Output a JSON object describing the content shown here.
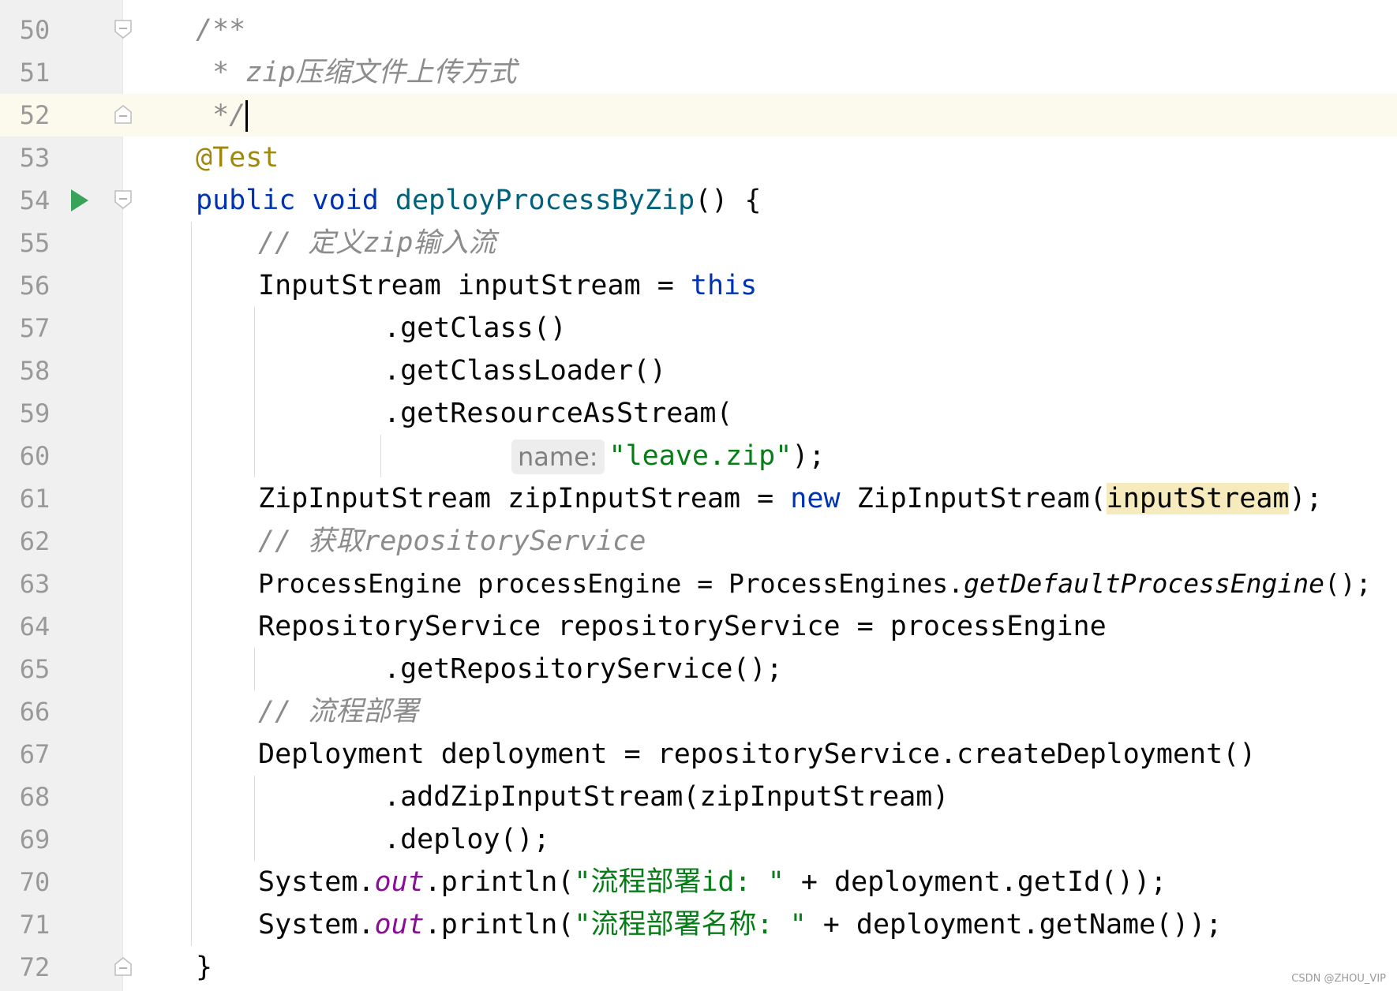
{
  "editor": {
    "lines": [
      {
        "n": "50",
        "text": "/**"
      },
      {
        "n": "51",
        "text": " * zip压缩文件上传方式"
      },
      {
        "n": "52",
        "text": " */"
      },
      {
        "n": "53",
        "text": "@Test"
      },
      {
        "n": "54",
        "kw1": "public",
        "kw2": "void",
        "fn": "deployProcessByZip",
        "rest": "() {"
      },
      {
        "n": "55",
        "text": "// 定义zip输入流"
      },
      {
        "n": "56",
        "a": "InputStream inputStream = ",
        "kw": "this"
      },
      {
        "n": "57",
        "text": ".getClass()"
      },
      {
        "n": "58",
        "text": ".getClassLoader()"
      },
      {
        "n": "59",
        "text": ".getResourceAsStream("
      },
      {
        "n": "60",
        "hint": "name:",
        "str": "\"leave.zip\"",
        "rest": ");"
      },
      {
        "n": "61",
        "a": "ZipInputStream zipInputStream = ",
        "kw": "new",
        "b": " ZipInputStream(",
        "hl": "inputStream",
        "c": ");"
      },
      {
        "n": "62",
        "text": "// 获取repositoryService"
      },
      {
        "n": "63",
        "a": "ProcessEngine processEngine = ProcessEngines.",
        "it": "getDefaultProcessEngine",
        "c": "();"
      },
      {
        "n": "64",
        "text": "RepositoryService repositoryService = processEngine"
      },
      {
        "n": "65",
        "text": ".getRepositoryService();"
      },
      {
        "n": "66",
        "text": "// 流程部署"
      },
      {
        "n": "67",
        "text": "Deployment deployment = repositoryService.createDeployment()"
      },
      {
        "n": "68",
        "text": ".addZipInputStream(zipInputStream)"
      },
      {
        "n": "69",
        "text": ".deploy();"
      },
      {
        "n": "70",
        "a": "System.",
        "st": "out",
        "b": ".println(",
        "str": "\"流程部署id: \"",
        "c": " + deployment.getId());"
      },
      {
        "n": "71",
        "a": "System.",
        "st": "out",
        "b": ".println(",
        "str": "\"流程部署名称: \"",
        "c": " + deployment.getName());"
      },
      {
        "n": "72",
        "text": "}"
      }
    ]
  },
  "watermark": "CSDN @ZHOU_VIP",
  "colors": {
    "keyword": "#0033b3",
    "method_decl": "#00627a",
    "annotation": "#9e880d",
    "comment": "#8c8c8c",
    "string": "#067d17",
    "static_field": "#871094",
    "current_line": "#fcfaed",
    "gutter": "#f0f0f0",
    "run_icon": "#3aa35a"
  },
  "icons": {
    "run": "run-gutter-icon",
    "fold": "fold-icon"
  }
}
